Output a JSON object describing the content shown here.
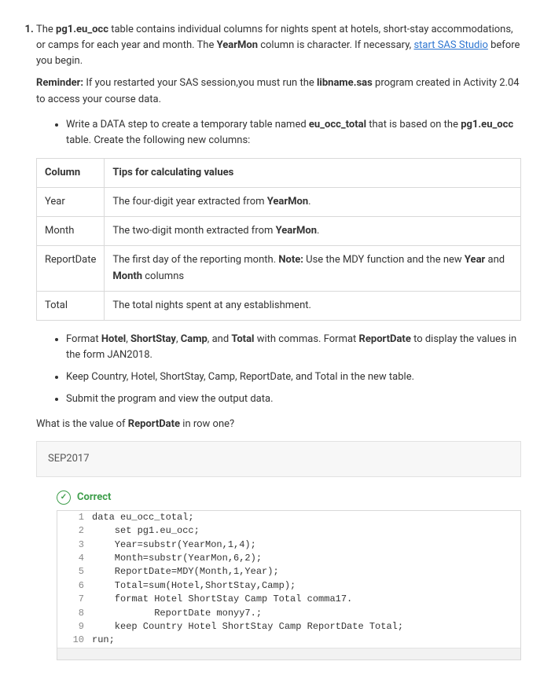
{
  "question_number": "1.",
  "intro": {
    "p1_pre": "The ",
    "p1_b1": "pg1.eu_occ",
    "p1_mid1": " table contains individual columns for nights spent at hotels, short-stay accommodations, or camps for each year and month. The ",
    "p1_b2": "YearMon",
    "p1_mid2": " column is character. If necessary, ",
    "p1_link": "start SAS Studio",
    "p1_post": " before you begin.",
    "rem_b": "Reminder:",
    "rem_mid1": " If you restarted your SAS session,you must run the ",
    "rem_b2": "libname.sas",
    "rem_post": " program created in Activity 2.04 to access your course data."
  },
  "bullet1": {
    "pre": "Write a DATA step to create a temporary table named ",
    "b1": "eu_occ_total",
    "mid": " that is based on the ",
    "b2": "pg1.eu_occ",
    "post": " table. Create the following new columns:"
  },
  "table": {
    "h1": "Column",
    "h2": "Tips for calculating values",
    "r1c1": "Year",
    "r1c2_pre": "The four-digit year extracted from ",
    "r1c2_b": "YearMon",
    "r1c2_post": ".",
    "r2c1": "Month",
    "r2c2_pre": "The two-digit month extracted from ",
    "r2c2_b": "YearMon",
    "r2c2_post": ".",
    "r3c1": "ReportDate",
    "r3c2_pre": "The first day of the reporting month. ",
    "r3c2_b1": "Note:",
    "r3c2_mid1": " Use the MDY function and the new ",
    "r3c2_b2": "Year",
    "r3c2_mid2": " and ",
    "r3c2_b3": "Month",
    "r3c2_post": " columns",
    "r4c1": "Total",
    "r4c2": "The total nights spent at any establishment."
  },
  "bullets_after": {
    "b1_pre": "Format ",
    "b1_h": "Hotel",
    "b1_s": ", ",
    "b1_ss": "ShortStay",
    "b1_c": "Camp",
    "b1_and": ", and ",
    "b1_t": "Total",
    "b1_mid": " with commas. Format ",
    "b1_rd": "ReportDate",
    "b1_post": " to display the values in the form JAN2018.",
    "b2": "Keep Country, Hotel, ShortStay, Camp, ReportDate, and Total in the new table.",
    "b3": "Submit the program and view the output data."
  },
  "question": {
    "pre": "What is the value of ",
    "b": "ReportDate",
    "post": " in row one?"
  },
  "answer": "SEP2017",
  "correct_label": "Correct",
  "code": [
    "data eu_occ_total;",
    "    set pg1.eu_occ;",
    "    Year=substr(YearMon,1,4);",
    "    Month=substr(YearMon,6,2);",
    "    ReportDate=MDY(Month,1,Year);",
    "    Total=sum(Hotel,ShortStay,Camp);",
    "    format Hotel ShortStay Camp Total comma17.",
    "           ReportDate monyy7.;",
    "    keep Country Hotel ShortStay Camp ReportDate Total;",
    "run;"
  ]
}
